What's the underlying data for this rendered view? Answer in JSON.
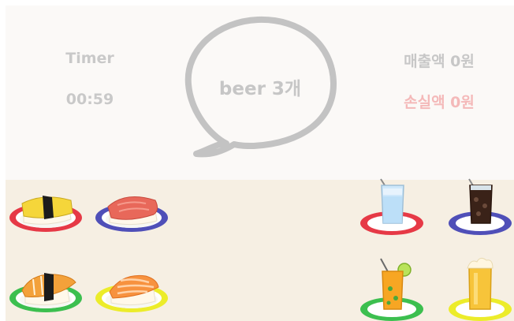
{
  "hud": {
    "timer_label": "Timer",
    "timer_value": "00:59",
    "sales_text": "매출액 0원",
    "loss_text": "손실액 0원"
  },
  "order": {
    "text": "beer 3개"
  },
  "colors": {
    "top_background": "#fbf9f7",
    "counter_background": "#f6efe3",
    "plate_red": "#e63946",
    "plate_blue": "#4f4fb8",
    "plate_green": "#3cbf4f",
    "plate_yellow": "#ecec2a",
    "loss_text": "#f4b9b9"
  },
  "menu": {
    "sushi": [
      {
        "name": "tamago-nigiri",
        "plate": "red"
      },
      {
        "name": "tuna-nigiri",
        "plate": "blue"
      },
      {
        "name": "shrimp-nigiri",
        "plate": "green"
      },
      {
        "name": "salmon-nigiri",
        "plate": "yellow"
      }
    ],
    "drinks": [
      {
        "name": "water",
        "plate": "red"
      },
      {
        "name": "cola",
        "plate": "blue"
      },
      {
        "name": "orange-juice",
        "plate": "green"
      },
      {
        "name": "beer",
        "plate": "yellow"
      }
    ]
  }
}
